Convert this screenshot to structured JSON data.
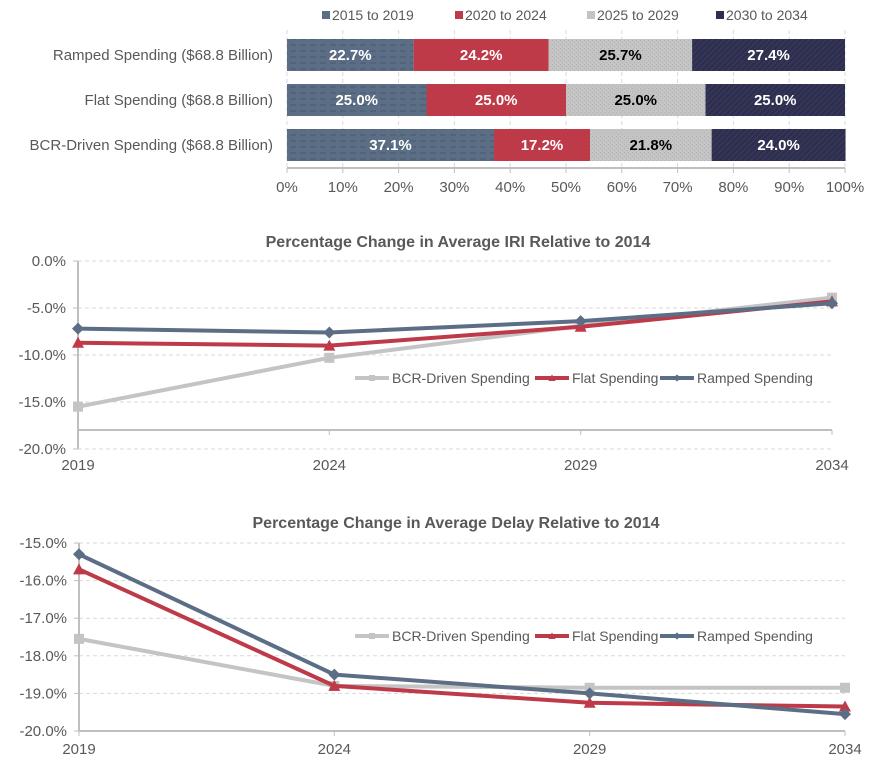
{
  "chart_data": [
    {
      "type": "bar",
      "stacked": true,
      "orientation": "horizontal",
      "title": "",
      "categories": [
        "Ramped Spending ($68.8 Billion)",
        "Flat Spending ($68.8 Billion)",
        "BCR-Driven Spending ($68.8 Billion)"
      ],
      "series": [
        {
          "name": "2015 to 2019",
          "color": "#5B6E85",
          "values": [
            22.7,
            25.0,
            37.1
          ],
          "labels": [
            "22.7%",
            "25.0%",
            "37.1%"
          ],
          "label_color": "#ffffff"
        },
        {
          "name": "2020 to 2024",
          "color": "#BE3A48",
          "values": [
            24.2,
            25.0,
            17.2
          ],
          "labels": [
            "24.2%",
            "25.0%",
            "17.2%"
          ],
          "label_color": "#ffffff"
        },
        {
          "name": "2025 to 2029",
          "color": "#C4C4C4",
          "values": [
            25.7,
            25.0,
            21.8
          ],
          "labels": [
            "25.7%",
            "25.0%",
            "21.8%"
          ],
          "label_color": "#000000"
        },
        {
          "name": "2030 to 2034",
          "color": "#2E2E4E",
          "values": [
            27.4,
            25.0,
            24.0
          ],
          "labels": [
            "27.4%",
            "25.0%",
            "24.0%"
          ],
          "label_color": "#ffffff"
        }
      ],
      "xlim": [
        0,
        100
      ],
      "xticks": [
        "0%",
        "10%",
        "20%",
        "30%",
        "40%",
        "50%",
        "60%",
        "70%",
        "80%",
        "90%",
        "100%"
      ],
      "legend": "top",
      "grid": true
    },
    {
      "type": "line",
      "title": "Percentage Change in Average IRI Relative to 2014",
      "x": [
        "2019",
        "2024",
        "2029",
        "2034"
      ],
      "series": [
        {
          "name": "BCR-Driven Spending",
          "color": "#C4C4C4",
          "marker": "square",
          "values": [
            -15.5,
            -10.3,
            -6.9,
            -3.9
          ]
        },
        {
          "name": "Flat Spending",
          "color": "#BE3A48",
          "marker": "triangle",
          "values": [
            -8.7,
            -9.0,
            -7.0,
            -4.3
          ]
        },
        {
          "name": "Ramped Spending",
          "color": "#5B6E85",
          "marker": "diamond",
          "values": [
            -7.2,
            -7.6,
            -6.4,
            -4.5
          ]
        }
      ],
      "ylim": [
        -20,
        0
      ],
      "yticks": [
        "0.0%",
        "-5.0%",
        "-10.0%",
        "-15.0%",
        "-20.0%"
      ],
      "x_axis_crosses": -18,
      "legend": "center-right",
      "grid": true
    },
    {
      "type": "line",
      "title": "Percentage Change in Average Delay Relative to 2014",
      "x": [
        "2019",
        "2024",
        "2029",
        "2034"
      ],
      "series": [
        {
          "name": "BCR-Driven Spending",
          "color": "#C4C4C4",
          "marker": "square",
          "values": [
            -17.55,
            -18.8,
            -18.85,
            -18.85
          ]
        },
        {
          "name": "Flat Spending",
          "color": "#BE3A48",
          "marker": "triangle",
          "values": [
            -15.7,
            -18.8,
            -19.25,
            -19.35
          ]
        },
        {
          "name": "Ramped Spending",
          "color": "#5B6E85",
          "marker": "diamond",
          "values": [
            -15.3,
            -18.5,
            -19.0,
            -19.55
          ]
        }
      ],
      "ylim": [
        -20,
        -15
      ],
      "yticks": [
        "-15.0%",
        "-16.0%",
        "-17.0%",
        "-18.0%",
        "-19.0%",
        "-20.0%"
      ],
      "legend": "center-right",
      "grid": true
    }
  ]
}
